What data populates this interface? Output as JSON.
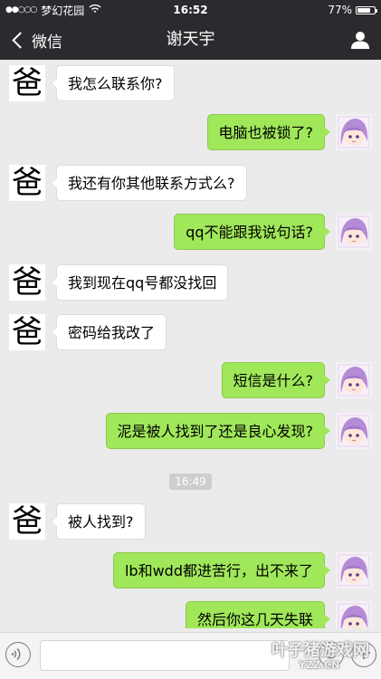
{
  "status_bar": {
    "carrier": "梦幻花园",
    "time": "16:52",
    "battery": "77%",
    "battery_level": 0.77
  },
  "nav": {
    "back_label": "微信",
    "title": "谢天宇",
    "profile_icon": "person-icon"
  },
  "dad_avatar_char": "爸",
  "messages": [
    {
      "side": "in",
      "text": "我怎么联系你?"
    },
    {
      "side": "out",
      "text": "电脑也被锁了?"
    },
    {
      "side": "in",
      "text": "我还有你其他联系方式么?"
    },
    {
      "side": "out",
      "text": "qq不能跟我说句话?"
    },
    {
      "side": "in",
      "text": "我到现在qq号都没找回"
    },
    {
      "side": "in",
      "text": "密码给我改了"
    },
    {
      "side": "out",
      "text": "短信是什么?"
    },
    {
      "side": "out",
      "text": "泥是被人找到了还是良心发现?"
    },
    {
      "side": "in",
      "text": "被人找到?"
    },
    {
      "side": "out",
      "text": "lb和wdd都进苦行，出不来了"
    },
    {
      "side": "out",
      "text": "然后你这几天失联"
    }
  ],
  "time_separator": "16:49",
  "input": {
    "voice_icon": "voice-icon",
    "emoji_icon": "emoji-icon",
    "plus_icon": "plus-icon"
  },
  "watermark": {
    "text": "叶子猪游戏网",
    "sub": "YZZ.CN"
  },
  "colors": {
    "bar_bg": "#2b2b2f",
    "chat_bg": "#ebebeb",
    "out_bubble": "#a0e75a",
    "in_bubble": "#ffffff"
  }
}
